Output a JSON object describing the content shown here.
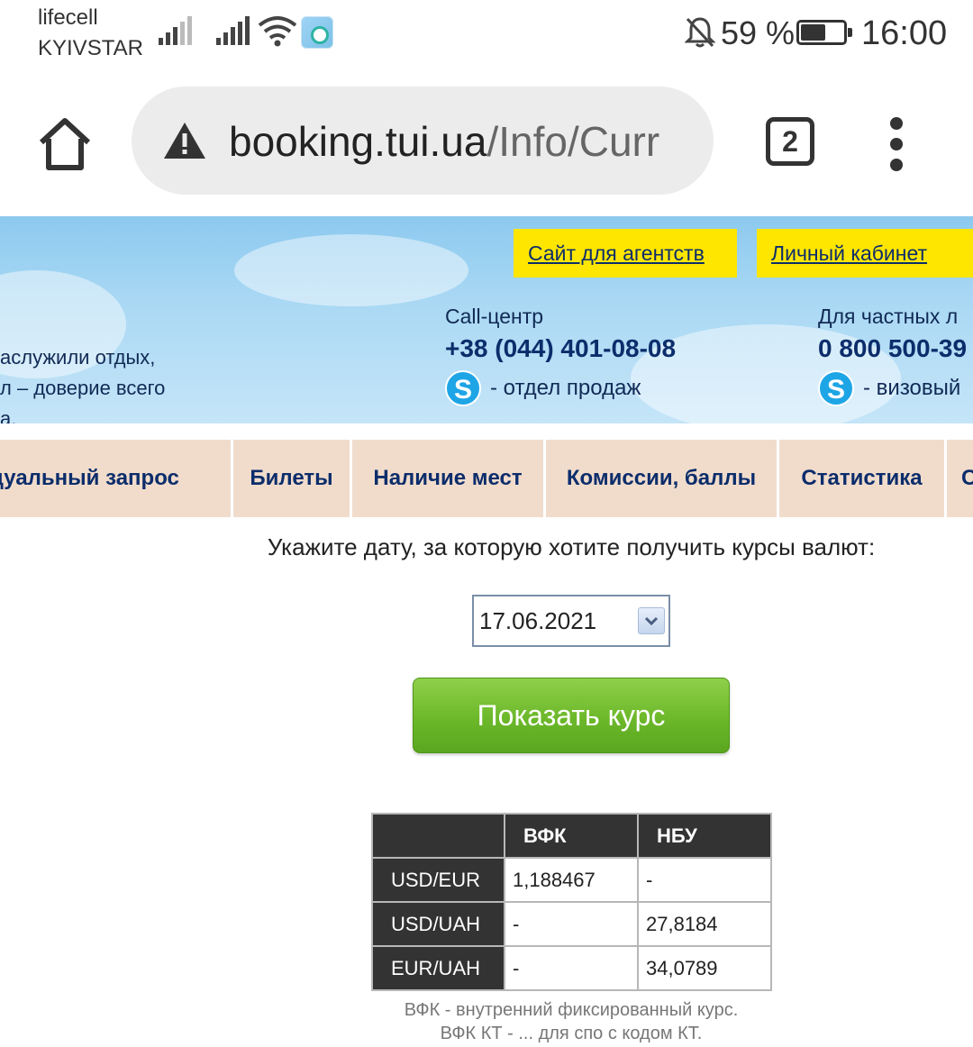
{
  "status_bar": {
    "carrier_1": "lifecell",
    "carrier_2": "KYIVSTAR",
    "icons": [
      "signal-icon",
      "signal-icon",
      "wifi-icon",
      "app-notification-icon",
      "bell-off-icon",
      "battery-icon"
    ],
    "battery_percent": "59 %",
    "battery_level": 0.59,
    "time": "16:00"
  },
  "browser": {
    "url_domain": "booking.tui.ua",
    "url_path": "/Info/Curr",
    "tab_count": "2"
  },
  "header": {
    "agents_link": "Сайт для агентств",
    "cabinet_link": "Личный кабинет",
    "slogan_lines": [
      "аслужили отдых,",
      "л – доверие всего",
      "а."
    ],
    "call_center": {
      "label": "Call-центр",
      "phone": "+38 (044) 401-08-08",
      "skype_text": "- отдел продаж"
    },
    "private": {
      "label": "Для частных л",
      "phone": "0 800 500-39",
      "skype_text": "- визовый"
    }
  },
  "nav": {
    "items": [
      "идуальный запрос",
      "Билеты",
      "Наличие мест",
      "Комиссии, баллы",
      "Статистика",
      "С"
    ]
  },
  "form": {
    "prompt": "Укажите дату, за которую хотите получить курсы валют:",
    "date_value": "17.06.2021",
    "show_button": "Показать курс"
  },
  "rates_table": {
    "headers": [
      "",
      "ВФК",
      "НБУ"
    ],
    "rows": [
      {
        "pair": "USD/EUR",
        "vfk": "1,188467",
        "nbu": "-"
      },
      {
        "pair": "USD/UAH",
        "vfk": "-",
        "nbu": "27,8184"
      },
      {
        "pair": "EUR/UAH",
        "vfk": "-",
        "nbu": "34,0789"
      }
    ]
  },
  "notes": [
    "ВФК - внутренний фиксированный курс.",
    "ВФК КТ - ... для спо с кодом КТ."
  ],
  "colors": {
    "header_sky": "#a9d8f4",
    "yellow_button": "#ffe600",
    "nav_bg": "#f1dccc",
    "nav_text": "#0c2d6b",
    "green_button": "#6cb82a",
    "table_dark": "#333333"
  }
}
